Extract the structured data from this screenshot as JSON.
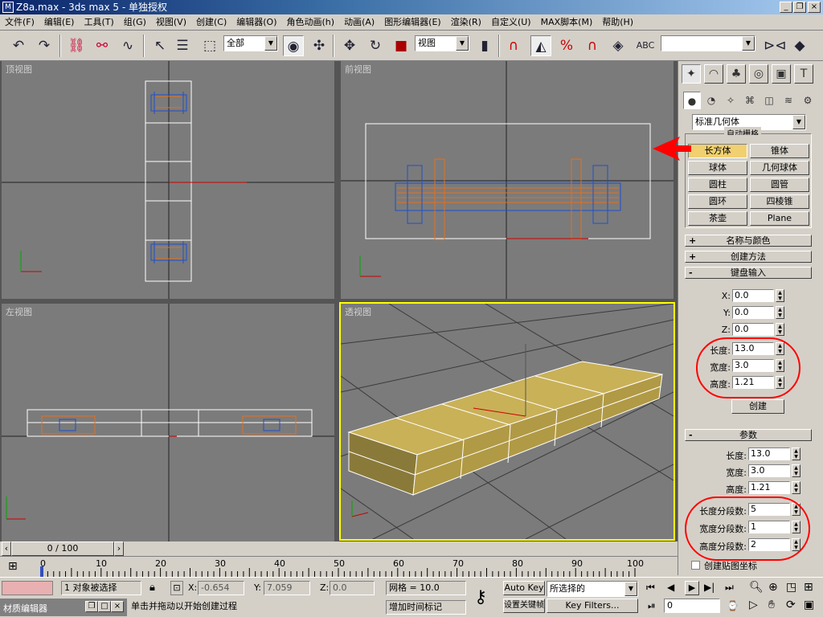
{
  "window": {
    "title": "Z8a.max - 3ds max 5 - 单独授权",
    "min": "_",
    "max": "❐",
    "close": "×"
  },
  "menu": [
    "文件(F)",
    "编辑(E)",
    "工具(T)",
    "组(G)",
    "视图(V)",
    "创建(C)",
    "编辑器(O)",
    "角色动画(h)",
    "动画(A)",
    "图形编辑器(E)",
    "渲染(R)",
    "自定义(U)",
    "MAX脚本(M)",
    "帮助(H)"
  ],
  "toolbar": {
    "selection_filter": "全部",
    "ref_coord": "视图",
    "named_selection": ""
  },
  "viewports": {
    "top": "顶视图",
    "front": "前视图",
    "left": "左视图",
    "perspective": "透视图"
  },
  "axis": {
    "x": "x",
    "y": "y",
    "z": "z"
  },
  "command_panel": {
    "category_dropdown": "标准几何体",
    "object_type_label": "自动栅格",
    "object_buttons": [
      "长方体",
      "锥体",
      "球体",
      "几何球体",
      "圆柱",
      "圆管",
      "圆环",
      "四棱锥",
      "茶壶",
      "Plane"
    ],
    "rollouts": {
      "name_color": "名称与颜色",
      "creation_method": "创建方法",
      "keyboard_entry": "键盘输入",
      "parameters": "参数"
    },
    "keyboard": {
      "x_label": "X:",
      "x": "0.0",
      "y_label": "Y:",
      "y": "0.0",
      "z_label": "Z:",
      "z": "0.0",
      "length_label": "长度:",
      "length": "13.0",
      "width_label": "宽度:",
      "width": "3.0",
      "height_label": "高度:",
      "height": "1.21",
      "create": "创建"
    },
    "params": {
      "length_label": "长度:",
      "length": "13.0",
      "width_label": "宽度:",
      "width": "3.0",
      "height_label": "高度:",
      "height": "1.21",
      "lseg_label": "长度分段数:",
      "lseg": "5",
      "wseg_label": "宽度分段数:",
      "wseg": "1",
      "hseg_label": "高度分段数:",
      "hseg": "2",
      "gen_map": "创建贴图坐标"
    },
    "signs": {
      "plus": "+",
      "minus": "-"
    }
  },
  "timeline": {
    "frame": "0 / 100",
    "ticks": [
      "0",
      "10",
      "20",
      "30",
      "40",
      "50",
      "60",
      "70",
      "80",
      "90",
      "100"
    ]
  },
  "status": {
    "selected": "1 对象被选择",
    "x_label": "X:",
    "x": "-0.654",
    "y_label": "Y:",
    "y": "7.059",
    "z_label": "Z:",
    "z": "0.0",
    "grid": "网格 = 10.0",
    "auto_key": "Auto Key",
    "set_key": "设置关键帧",
    "selection_set": "所选择的",
    "key_filters": "Key Filters...",
    "add_tag": "增加时间标记",
    "prompt": "单击并拖动以开始创建过程",
    "frame_field": "0",
    "material_editor": "材质编辑器"
  },
  "colors": {
    "viewport_bg": "#7b7b7b",
    "active_border": "#ffff00",
    "box_fill": "#b9a13f",
    "wire_blue": "#1f4fc8",
    "wire_orange": "#e07020",
    "annotation_red": "#ff0000",
    "active_button": "#f0d070"
  }
}
